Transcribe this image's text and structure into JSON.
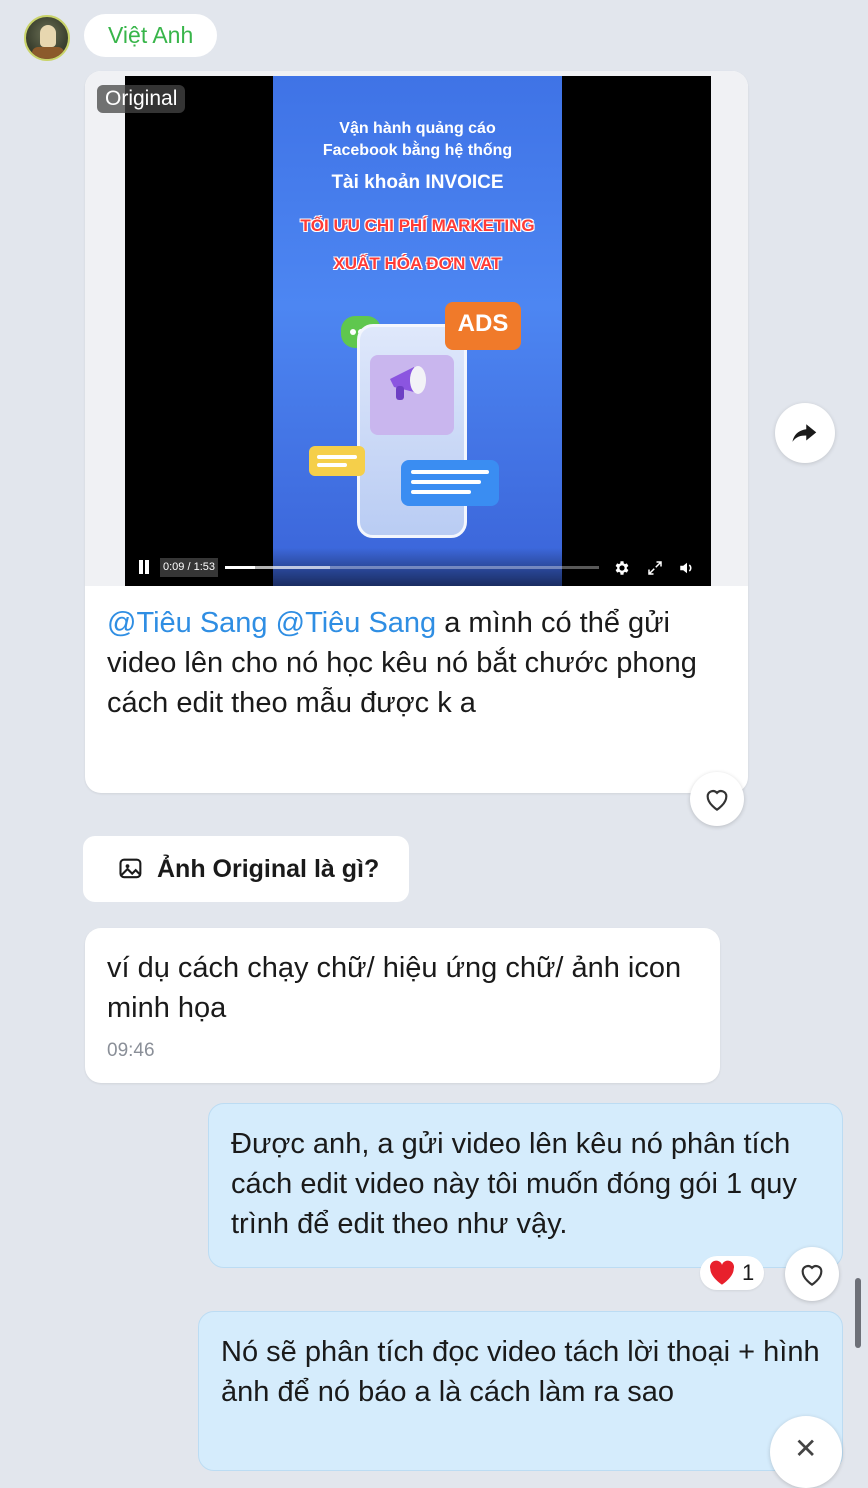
{
  "sender": {
    "name": "Việt Anh"
  },
  "media_message": {
    "badge": "Original",
    "video": {
      "title_line1": "Vận hành quảng cáo",
      "title_line2": "Facebook bằng hệ thống",
      "title_line3": "Tài khoản INVOICE",
      "title_line4": "TỐI ƯU CHI PHÍ MARKETING",
      "title_line5": "XUẤT HÓA ĐƠN VAT",
      "ads_label": "ADS",
      "time": "0:09 / 1:53",
      "progress": 0.08,
      "buffered": 0.28
    },
    "caption_mention1": "@Tiêu Sang",
    "caption_mention2": "@Tiêu Sang",
    "caption_text": " a mình có thể gửi video lên cho nó học kêu nó bắt chước phong cách edit theo mẫu được k a"
  },
  "info_pill": {
    "label": "Ảnh Original là gì?"
  },
  "messages": [
    {
      "direction": "in",
      "text": "ví dụ cách chạy chữ/ hiệu ứng chữ/ ảnh icon minh họa",
      "time": "09:46"
    },
    {
      "direction": "out",
      "text": "Được anh, a gửi video lên kêu nó phân tích cách edit video này tôi muốn đóng gói 1 quy trình để edit theo như vậy.",
      "reaction_count": "1"
    },
    {
      "direction": "out",
      "text": "Nó sẽ phân tích đọc video tách lời thoại + hình ảnh để nó báo a là cách làm ra sao"
    }
  ],
  "colors": {
    "background": "#e2e6ed",
    "sender_name": "#38b54a",
    "mention": "#2f8ee3",
    "outgoing_bubble": "#d5ecfc",
    "reaction_heart": "#e8202c"
  },
  "icons": [
    "avatar",
    "pause-icon",
    "settings-icon",
    "fullscreen-icon",
    "volume-icon",
    "forward-icon",
    "heart-outline-icon",
    "image-icon",
    "heart-filled-icon",
    "close-icon"
  ]
}
